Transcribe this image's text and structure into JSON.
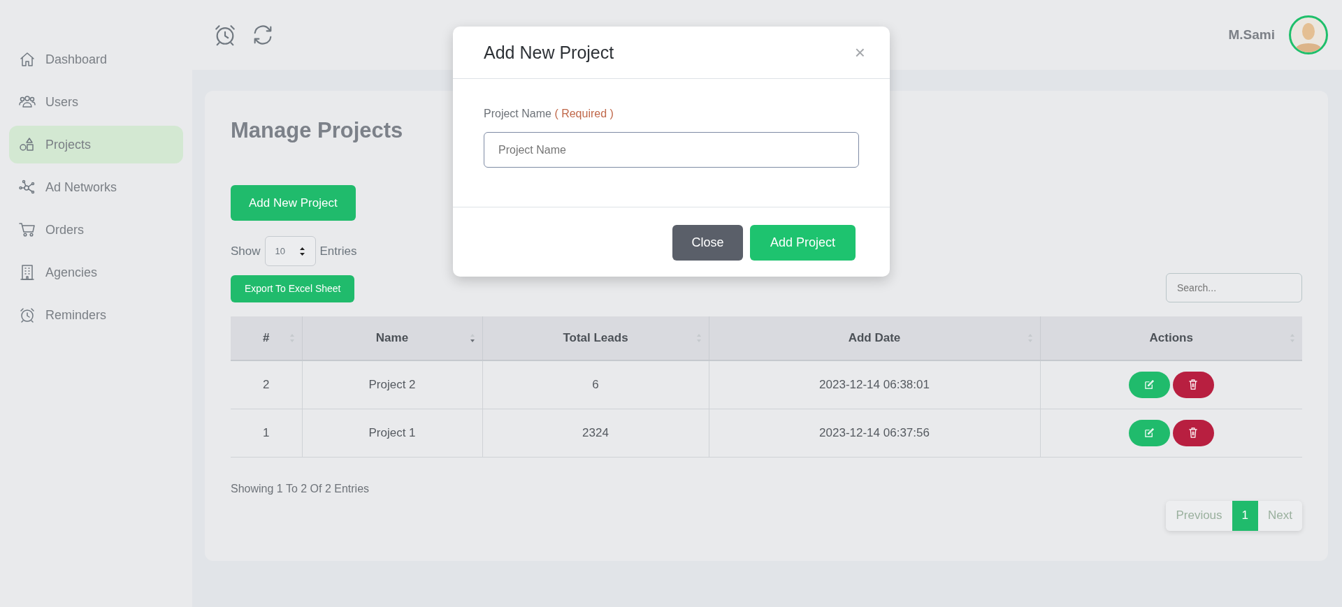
{
  "sidebar": {
    "items": [
      {
        "label": "Dashboard",
        "selected": false
      },
      {
        "label": "Users",
        "selected": false
      },
      {
        "label": "Projects",
        "selected": true
      },
      {
        "label": "Ad Networks",
        "selected": false
      },
      {
        "label": "Orders",
        "selected": false
      },
      {
        "label": "Agencies",
        "selected": false
      },
      {
        "label": "Reminders",
        "selected": false
      }
    ]
  },
  "header": {
    "user_name": "M.Sami"
  },
  "page": {
    "title": "Manage Projects",
    "add_button": "Add New Project",
    "show_label": "Show",
    "entries_value": "10",
    "entries_label": "Entries",
    "export_button": "Export To Excel Sheet",
    "search_placeholder": "Search...",
    "table": {
      "columns": [
        {
          "label": "#",
          "sorted": false
        },
        {
          "label": "Name",
          "sorted": true
        },
        {
          "label": "Total Leads",
          "sorted": false
        },
        {
          "label": "Add Date",
          "sorted": false
        },
        {
          "label": "Actions",
          "sorted": false
        }
      ],
      "rows": [
        {
          "number": "2",
          "name": "Project 2",
          "total_leads": "6",
          "add_date": "2023-12-14 06:38:01"
        },
        {
          "number": "1",
          "name": "Project 1",
          "total_leads": "2324",
          "add_date": "2023-12-14 06:37:56"
        }
      ]
    },
    "footer_text": "Showing 1 To 2 Of 2 Entries",
    "pagination": [
      {
        "label": "Previous",
        "selected": false
      },
      {
        "label": "1",
        "selected": true
      },
      {
        "label": "Next",
        "selected": false
      }
    ]
  },
  "modal": {
    "title": "Add New Project",
    "close_symbol": "×",
    "field_label": "Project Name",
    "required_text": "( Required )",
    "field_placeholder": "Project Name",
    "buttons": [
      {
        "label": "Close",
        "kind": "secondary"
      },
      {
        "label": "Add Project",
        "kind": "primary"
      }
    ]
  }
}
